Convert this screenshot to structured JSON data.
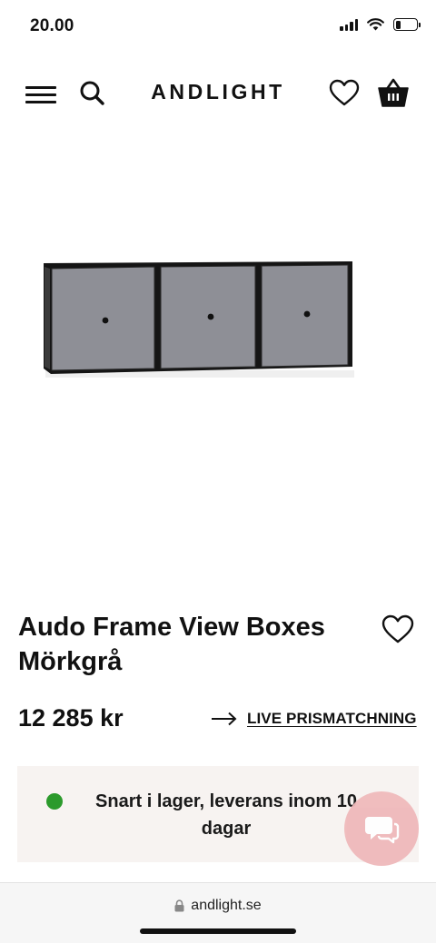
{
  "status_bar": {
    "time": "20.00",
    "icons": [
      "signal-icon",
      "wifi-icon",
      "battery-icon"
    ],
    "battery_level": 0.25
  },
  "header": {
    "logo": "ANDLIGHT",
    "icons": [
      "menu-icon",
      "search-icon",
      "heart-icon",
      "basket-icon"
    ]
  },
  "product": {
    "title": "Audo Frame View Boxes Mörkgrå",
    "price": "12 285 kr",
    "price_match_label": "LIVE PRISMATCHNING",
    "stock_text": "Snart i lager, leverans inom 10 dagar",
    "stock_status_color": "#2c9a2c",
    "box_color": "#8e8f96"
  },
  "chat": {
    "icon": "chat-icon",
    "color": "#efb9bb"
  },
  "browser": {
    "url": "andlight.se",
    "icon": "lock-icon"
  }
}
